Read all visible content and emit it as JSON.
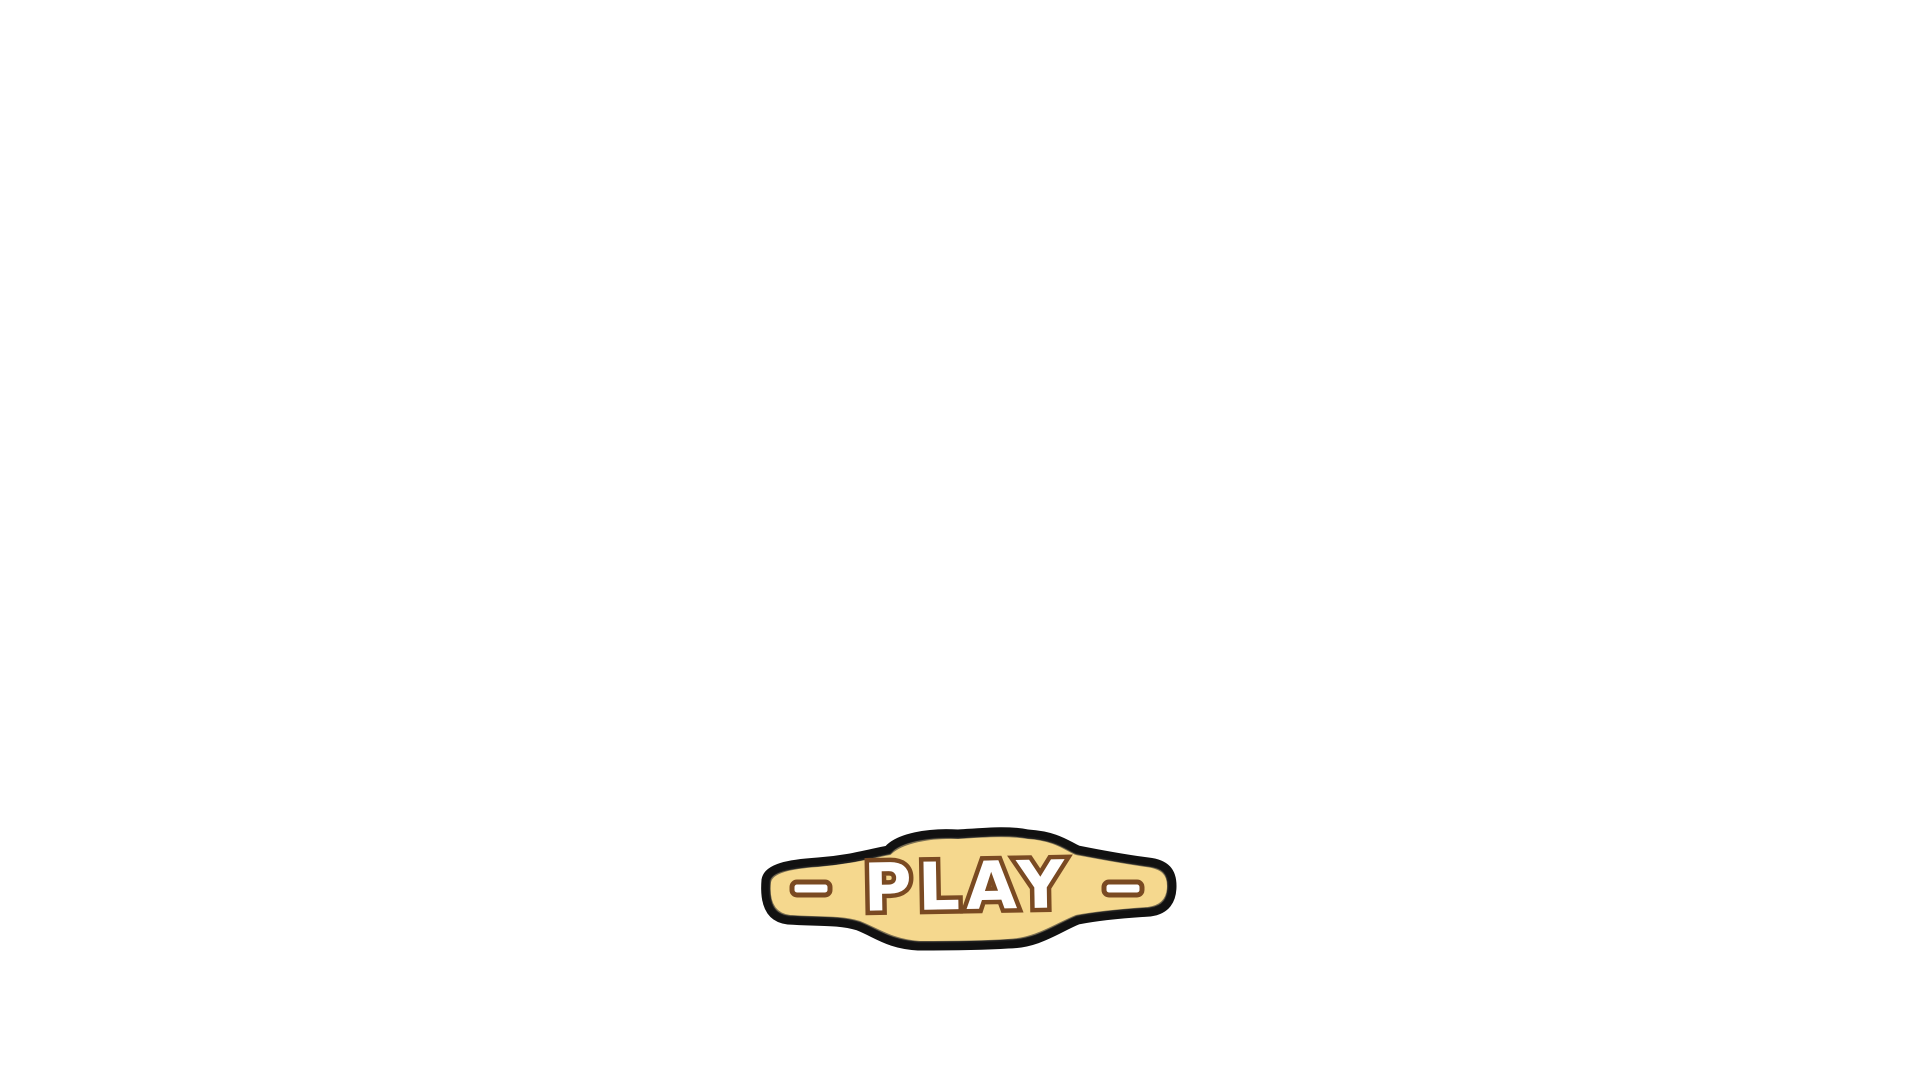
{
  "menu": {
    "play_label": "PLAY"
  },
  "colors": {
    "background": "#ffffff",
    "button_fill": "#f5d88e",
    "button_outline": "#111111",
    "text_outline": "#7a4a22",
    "text_fill": "#ffffff",
    "dash": "#7a4a22"
  },
  "icons": {
    "left_decoration": "dash-icon",
    "right_decoration": "dash-icon"
  }
}
